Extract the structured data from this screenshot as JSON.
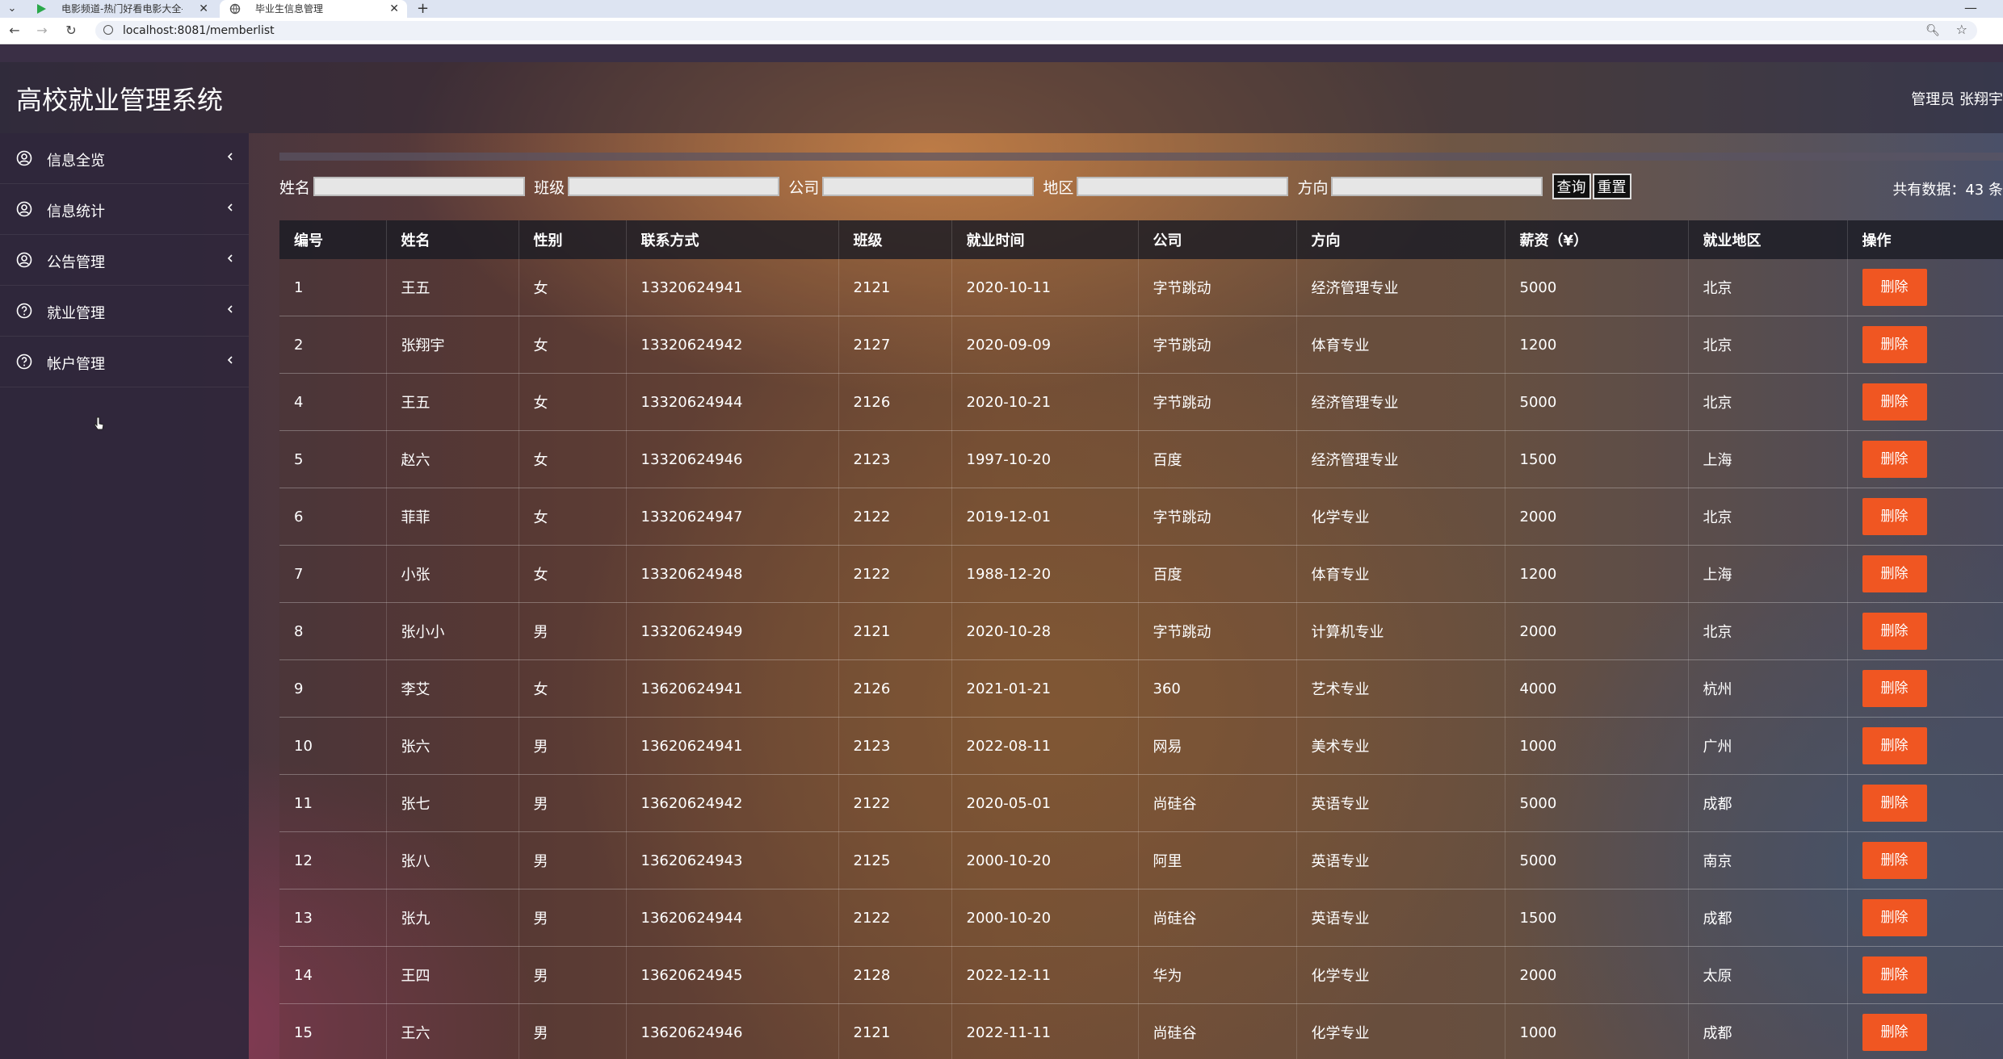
{
  "browser": {
    "tabs": [
      {
        "title": "电影频道-热门好看电影大全-正",
        "active": false
      },
      {
        "title": "毕业生信息管理",
        "active": true
      }
    ],
    "url": "localhost:8081/memberlist"
  },
  "header": {
    "system_title": "高校就业管理系统",
    "admin_label": "管理员 张翔宇"
  },
  "sidebar": {
    "items": [
      {
        "label": "信息全览",
        "icon": "user-circle-icon"
      },
      {
        "label": "信息统计",
        "icon": "user-circle-icon"
      },
      {
        "label": "公告管理",
        "icon": "user-circle-icon"
      },
      {
        "label": "就业管理",
        "icon": "question-circle-icon"
      },
      {
        "label": "帐户管理",
        "icon": "question-circle-icon"
      }
    ]
  },
  "search": {
    "name_label": "姓名",
    "class_label": "班级",
    "company_label": "公司",
    "region_label": "地区",
    "major_label": "方向",
    "query_label": "查询",
    "reset_label": "重置",
    "total_text": "共有数据：43 条"
  },
  "table": {
    "columns": [
      "编号",
      "姓名",
      "性别",
      "联系方式",
      "班级",
      "就业时间",
      "公司",
      "方向",
      "薪资（¥）",
      "就业地区",
      "操作"
    ],
    "delete_label": "删除",
    "rows": [
      [
        "1",
        "王五",
        "女",
        "13320624941",
        "2121",
        "2020-10-11",
        "字节跳动",
        "经济管理专业",
        "5000",
        "北京"
      ],
      [
        "2",
        "张翔宇",
        "女",
        "13320624942",
        "2127",
        "2020-09-09",
        "字节跳动",
        "体育专业",
        "1200",
        "北京"
      ],
      [
        "4",
        "王五",
        "女",
        "13320624944",
        "2126",
        "2020-10-21",
        "字节跳动",
        "经济管理专业",
        "5000",
        "北京"
      ],
      [
        "5",
        "赵六",
        "女",
        "13320624946",
        "2123",
        "1997-10-20",
        "百度",
        "经济管理专业",
        "1500",
        "上海"
      ],
      [
        "6",
        "菲菲",
        "女",
        "13320624947",
        "2122",
        "2019-12-01",
        "字节跳动",
        "化学专业",
        "2000",
        "北京"
      ],
      [
        "7",
        "小张",
        "女",
        "13320624948",
        "2122",
        "1988-12-20",
        "百度",
        "体育专业",
        "1200",
        "上海"
      ],
      [
        "8",
        "张小小",
        "男",
        "13320624949",
        "2121",
        "2020-10-28",
        "字节跳动",
        "计算机专业",
        "2000",
        "北京"
      ],
      [
        "9",
        "李艾",
        "女",
        "13620624941",
        "2126",
        "2021-01-21",
        "360",
        "艺术专业",
        "4000",
        "杭州"
      ],
      [
        "10",
        "张六",
        "男",
        "13620624941",
        "2123",
        "2022-08-11",
        "网易",
        "美术专业",
        "1000",
        "广州"
      ],
      [
        "11",
        "张七",
        "男",
        "13620624942",
        "2122",
        "2020-05-01",
        "尚硅谷",
        "英语专业",
        "5000",
        "成都"
      ],
      [
        "12",
        "张八",
        "男",
        "13620624943",
        "2125",
        "2000-10-20",
        "阿里",
        "英语专业",
        "5000",
        "南京"
      ],
      [
        "13",
        "张九",
        "男",
        "13620624944",
        "2122",
        "2000-10-20",
        "尚硅谷",
        "英语专业",
        "1500",
        "成都"
      ],
      [
        "14",
        "王四",
        "男",
        "13620624945",
        "2128",
        "2022-12-11",
        "华为",
        "化学专业",
        "2000",
        "太原"
      ],
      [
        "15",
        "王六",
        "男",
        "13620624946",
        "2121",
        "2022-11-11",
        "尚硅谷",
        "化学专业",
        "1000",
        "成都"
      ]
    ]
  }
}
